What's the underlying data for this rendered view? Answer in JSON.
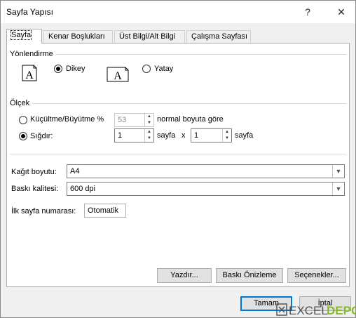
{
  "window": {
    "title": "Sayfa Yapısı",
    "help_label": "?",
    "close_label": "✕"
  },
  "tabs": [
    {
      "label": "Sayfa",
      "active": true
    },
    {
      "label": "Kenar Boşlukları",
      "active": false
    },
    {
      "label": "Üst Bilgi/Alt Bilgi",
      "active": false
    },
    {
      "label": "Çalışma Sayfası",
      "active": false
    }
  ],
  "orientation": {
    "section_label": "Yönlendirme",
    "portrait_label": "Dikey",
    "landscape_label": "Yatay",
    "selected": "portrait",
    "icon_glyph": "A"
  },
  "scaling": {
    "section_label": "Ölçek",
    "adjust_label": "Küçültme/Büyütme %",
    "adjust_value": "53",
    "adjust_suffix": "normal boyuta göre",
    "fit_label": "Sığdır:",
    "fit_wide_value": "1",
    "fit_wide_suffix": "sayfa",
    "times_label": "x",
    "fit_tall_value": "1",
    "fit_tall_suffix": "sayfa",
    "selected": "fit"
  },
  "paper": {
    "size_label": "Kağıt boyutu:",
    "size_value": "A4",
    "quality_label": "Baskı kalitesi:",
    "quality_value": "600 dpi",
    "first_page_label": "İlk sayfa numarası:",
    "first_page_value": "Otomatik"
  },
  "buttons": {
    "print": "Yazdır...",
    "preview": "Baskı Önizleme",
    "options": "Seçenekler...",
    "ok": "Tamam",
    "cancel": "İptal"
  },
  "watermark": {
    "text": "EXCEL",
    "text2": "DEPO"
  },
  "colors": {
    "accent": "#0078d7",
    "watermark_green": "#86bc25"
  }
}
